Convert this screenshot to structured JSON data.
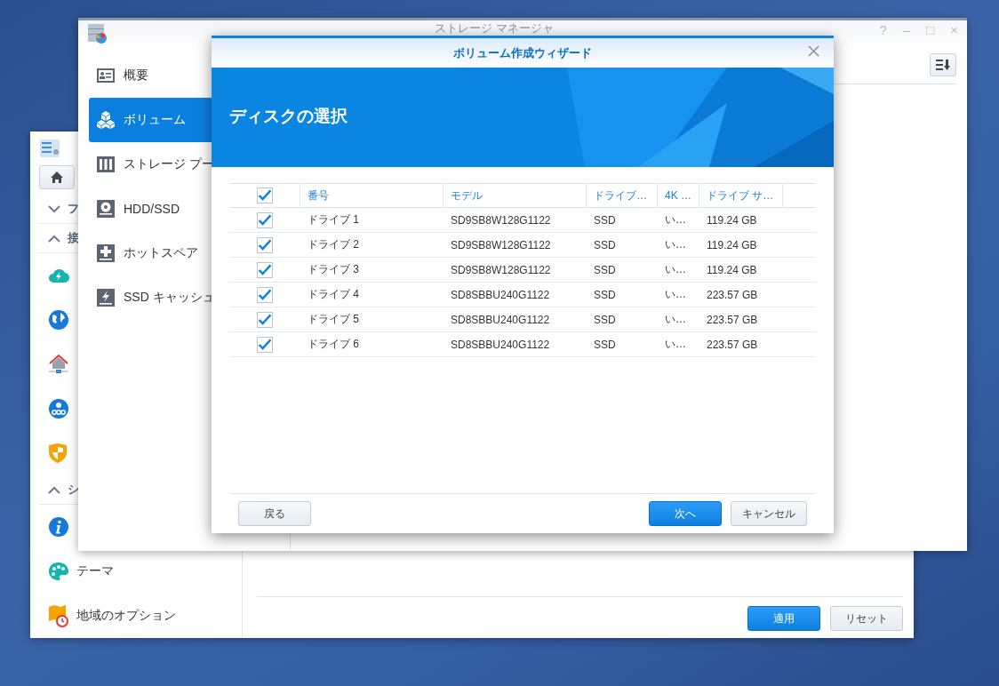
{
  "control_panel": {
    "sidebar": {
      "sections": [
        {
          "label": "フ",
          "expanded": false
        },
        {
          "label": "接",
          "expanded": true
        },
        {
          "label": "シ",
          "expanded": true,
          "items": [
            {
              "label": "テーマ"
            },
            {
              "label": "地域のオプション"
            }
          ]
        }
      ]
    },
    "buttons": [
      {
        "label": "適用",
        "kind": "primary"
      },
      {
        "label": "リセット",
        "kind": "secondary"
      }
    ]
  },
  "storage_manager": {
    "title": "ストレージ マネージャ",
    "window_controls": [
      "?",
      "–",
      "□",
      "×"
    ],
    "sidebar": {
      "items": [
        {
          "label": "概要",
          "selected": false
        },
        {
          "label": "ボリューム",
          "selected": true
        },
        {
          "label": "ストレージ プー",
          "selected": false
        },
        {
          "label": "HDD/SSD",
          "selected": false
        },
        {
          "label": "ホットスペア",
          "selected": false
        },
        {
          "label": "SSD キャッシュ",
          "selected": false
        }
      ]
    }
  },
  "wizard": {
    "title": "ボリューム作成ウィザード",
    "heading": "ディスクの選択",
    "table": {
      "all_checked": true,
      "columns": [
        "番号",
        "モデル",
        "ドライブ…",
        "4K …",
        "ドライブ サ…"
      ],
      "rows": [
        {
          "checked": true,
          "cells": [
            "ドライブ 1",
            "SD9SB8W128G1122",
            "SSD",
            "い…",
            "119.24 GB"
          ]
        },
        {
          "checked": true,
          "cells": [
            "ドライブ 2",
            "SD9SB8W128G1122",
            "SSD",
            "い…",
            "119.24 GB"
          ]
        },
        {
          "checked": true,
          "cells": [
            "ドライブ 3",
            "SD9SB8W128G1122",
            "SSD",
            "い…",
            "119.24 GB"
          ]
        },
        {
          "checked": true,
          "cells": [
            "ドライブ 4",
            "SD8SBBU240G1122",
            "SSD",
            "い…",
            "223.57 GB"
          ]
        },
        {
          "checked": true,
          "cells": [
            "ドライブ 5",
            "SD8SBBU240G1122",
            "SSD",
            "い…",
            "223.57 GB"
          ]
        },
        {
          "checked": true,
          "cells": [
            "ドライブ 6",
            "SD8SBBU240G1122",
            "SSD",
            "い…",
            "223.57 GB"
          ]
        }
      ]
    },
    "buttons": [
      {
        "label": "戻る",
        "kind": "secondary"
      },
      {
        "label": "次へ",
        "kind": "primary"
      },
      {
        "label": "キャンセル",
        "kind": "secondary"
      }
    ]
  }
}
